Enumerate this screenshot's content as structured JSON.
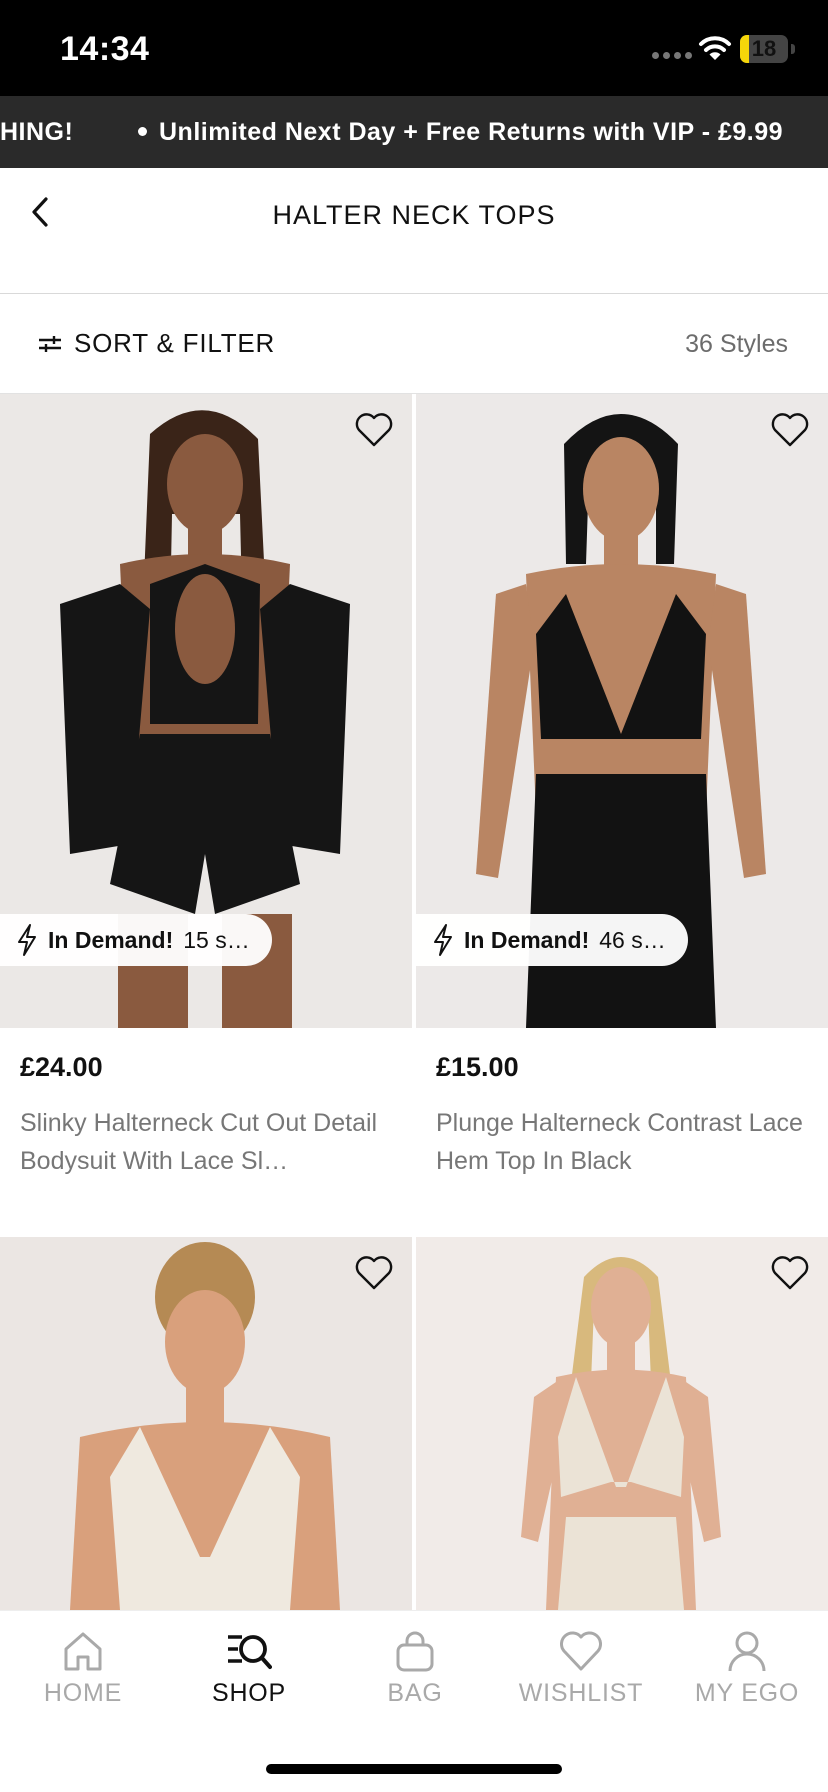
{
  "status_bar": {
    "time": "14:34",
    "battery_level": "18",
    "battery_fraction": 0.18
  },
  "promo": {
    "left_fragment": "HING!",
    "message": "Unlimited Next Day + Free Returns with VIP - £9.99"
  },
  "header": {
    "title": "HALTER NECK TOPS"
  },
  "filter_bar": {
    "sort_filter_label": "SORT & FILTER",
    "styles_count": "36 Styles"
  },
  "products": [
    {
      "price": "£24.00",
      "name": "Slinky Halterneck Cut Out Detail Bodysuit With Lace Sl…",
      "badge_label": "In Demand!",
      "badge_count": "15 s…",
      "image_colors": {
        "bg": "#ebe8e6",
        "skin": "#8a5a3f",
        "garment": "#151515",
        "hair": "#3a2418"
      }
    },
    {
      "price": "£15.00",
      "name": "Plunge Halterneck Contrast Lace Hem Top In Black",
      "badge_label": "In Demand!",
      "badge_count": "46 s…",
      "image_colors": {
        "bg": "#ece9e8",
        "skin": "#b98563",
        "garment": "#121212",
        "hair": "#141414"
      }
    },
    {
      "image_colors": {
        "bg": "#ebe6e3",
        "skin": "#d9a07c",
        "garment": "#efe9df",
        "hair": "#b58a54"
      }
    },
    {
      "image_colors": {
        "bg": "#f1ebe8",
        "skin": "#e0b094",
        "garment": "#ebe3d6",
        "hair": "#d8b97d"
      }
    }
  ],
  "tabs": [
    {
      "label": "HOME",
      "icon": "home-icon",
      "active": false
    },
    {
      "label": "SHOP",
      "icon": "shop-search-icon",
      "active": true
    },
    {
      "label": "BAG",
      "icon": "bag-icon",
      "active": false
    },
    {
      "label": "WISHLIST",
      "icon": "heart-icon",
      "active": false
    },
    {
      "label": "MY EGO",
      "icon": "profile-icon",
      "active": false
    }
  ]
}
